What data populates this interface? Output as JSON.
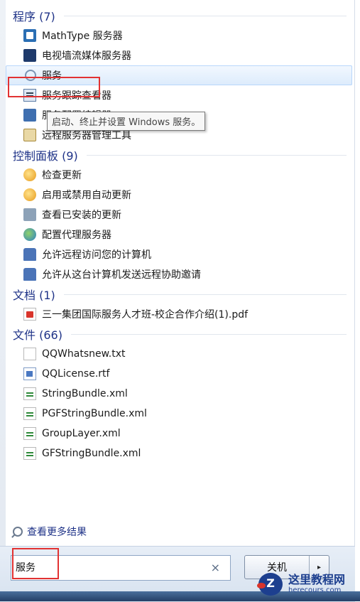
{
  "groups": [
    {
      "title": "程序 (7)",
      "items": [
        {
          "label": "MathType 服务器",
          "icon": "mathtype-icon"
        },
        {
          "label": "电视墙流媒体服务器",
          "icon": "tv-wall-icon"
        },
        {
          "label": "服务",
          "icon": "services-icon",
          "selected": true
        },
        {
          "label": "服务跟踪查看器",
          "icon": "trace-viewer-icon"
        },
        {
          "label": "服务配置编辑器",
          "icon": "config-editor-icon"
        },
        {
          "label": "远程服务器管理工具",
          "icon": "remote-admin-icon"
        }
      ]
    },
    {
      "title": "控制面板 (9)",
      "items": [
        {
          "label": "检查更新",
          "icon": "windows-update-icon"
        },
        {
          "label": "启用或禁用自动更新",
          "icon": "windows-update-icon"
        },
        {
          "label": "查看已安装的更新",
          "icon": "installed-updates-icon"
        },
        {
          "label": "配置代理服务器",
          "icon": "proxy-icon"
        },
        {
          "label": "允许远程访问您的计算机",
          "icon": "remote-user-icon"
        },
        {
          "label": "允许从这台计算机发送远程协助邀请",
          "icon": "remote-user-icon"
        }
      ]
    },
    {
      "title": "文档 (1)",
      "items": [
        {
          "label": "三一集团国际服务人才班-校企合作介绍(1).pdf",
          "icon": "pdf-icon"
        }
      ]
    },
    {
      "title": "文件 (66)",
      "items": [
        {
          "label": "QQWhatsnew.txt",
          "icon": "text-file-icon"
        },
        {
          "label": "QQLicense.rtf",
          "icon": "rtf-file-icon"
        },
        {
          "label": "StringBundle.xml",
          "icon": "xml-file-icon"
        },
        {
          "label": "PGFStringBundle.xml",
          "icon": "xml-file-icon"
        },
        {
          "label": "GroupLayer.xml",
          "icon": "xml-file-icon"
        },
        {
          "label": "GFStringBundle.xml",
          "icon": "xml-file-icon"
        }
      ]
    }
  ],
  "tooltip": "启动、终止并设置 Windows 服务。",
  "see_more": "查看更多结果",
  "search": {
    "value": "服务",
    "clear": "×"
  },
  "shutdown": {
    "label": "关机",
    "arrow": "▸"
  },
  "watermark": {
    "brand": "这里教程网",
    "domain": "herecours.com"
  },
  "colors": {
    "accent": "#1e3287",
    "highlight": "#e23232",
    "selection": "#dcebfc"
  }
}
